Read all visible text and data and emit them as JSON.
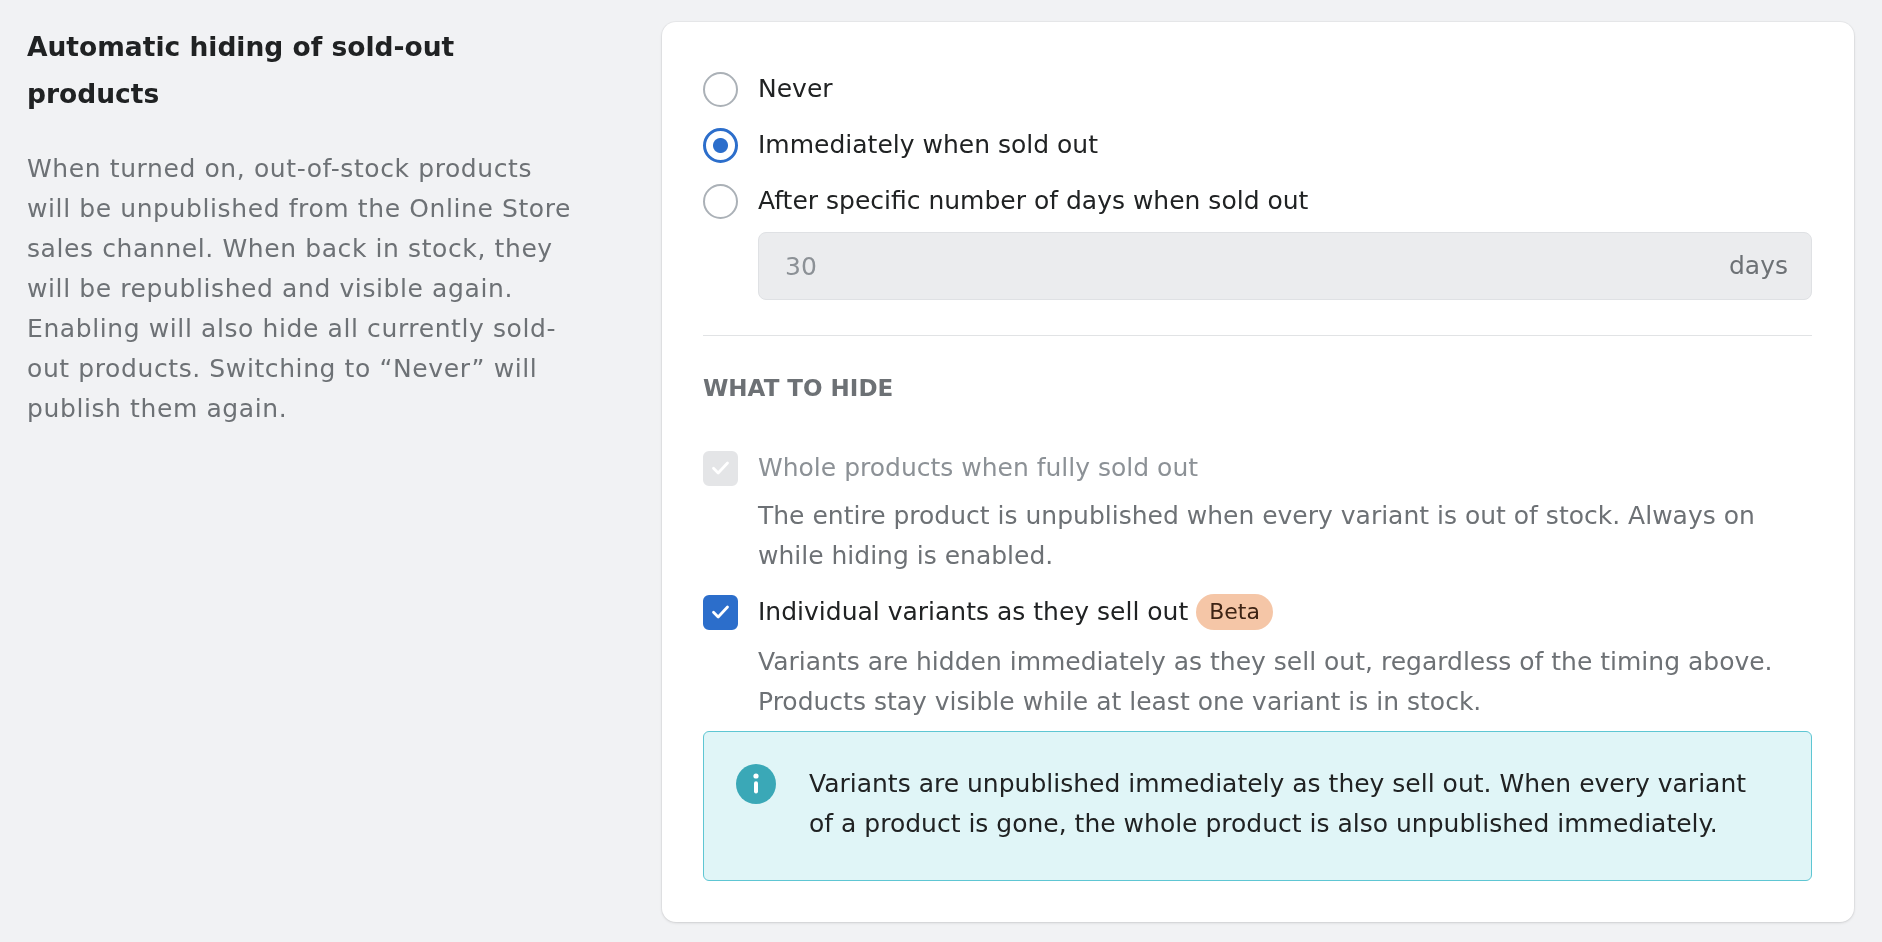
{
  "section": {
    "title": "Automatic hiding of sold-out products",
    "description": "When turned on, out-of-stock products will be unpublished from the Online Store sales channel. When back in stock, they will be republished and visible again. Enabling will also hide all currently sold-out products. Switching to “Never” will publish them again."
  },
  "timing": {
    "options": [
      {
        "label": "Never",
        "selected": false
      },
      {
        "label": "Immediately when sold out",
        "selected": true
      },
      {
        "label": "After specific number of days when sold out",
        "selected": false
      }
    ],
    "days_field": {
      "value": "30",
      "suffix": "days",
      "disabled": true
    }
  },
  "what_to_hide": {
    "heading": "WHAT TO HIDE",
    "options": [
      {
        "label": "Whole products when fully sold out",
        "checked": true,
        "disabled": true,
        "description": "The entire product is unpublished when every variant is out of stock. Always on while hiding is enabled."
      },
      {
        "label": "Individual variants as they sell out",
        "checked": true,
        "disabled": false,
        "badge": "Beta",
        "description": "Variants are hidden immediately as they sell out, regardless of the timing above. Products stay visible while at least one variant is in stock."
      }
    ]
  },
  "info_banner": {
    "text": "Variants are unpublished immediately as they sell out. When every variant of a product is gone, the whole product is also unpublished immediately."
  }
}
